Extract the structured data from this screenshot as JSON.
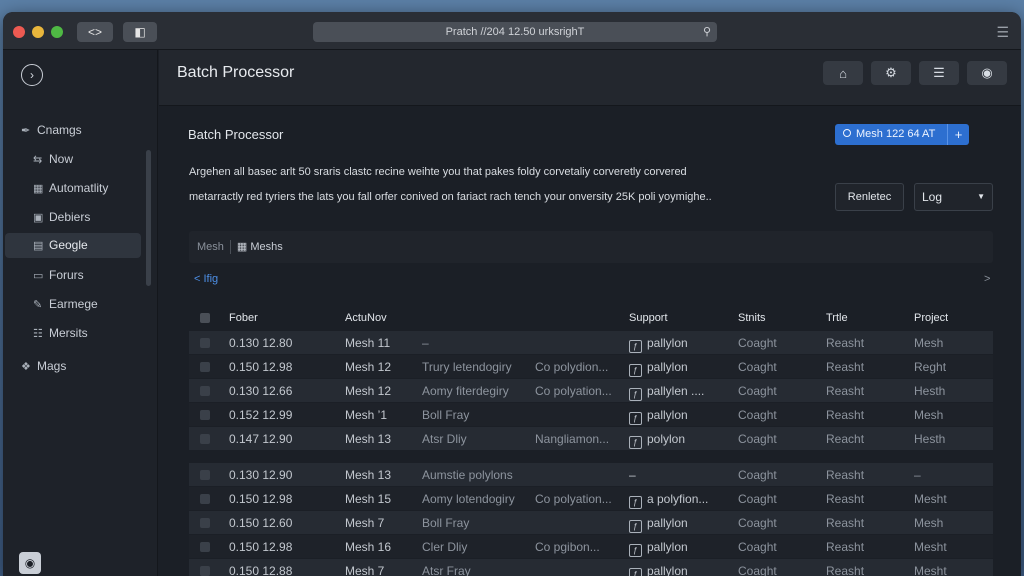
{
  "titlebar": {
    "url": "Pratch //204 12.50 urksrighT",
    "back_icon": "code-brackets-icon",
    "side_icon": "sidebar-toggle-icon",
    "search_icon": "search-icon",
    "menu_icon": "hamburger-icon"
  },
  "sidebar": {
    "items": [
      {
        "label": "Cnamgs",
        "icon": "link-icon"
      },
      {
        "label": "Now",
        "icon": "sync-icon"
      },
      {
        "label": "Automatlity",
        "icon": "grid-icon"
      },
      {
        "label": "Debiers",
        "icon": "document-icon"
      },
      {
        "label": "Geogle",
        "icon": "layers-icon"
      },
      {
        "label": "Forurs",
        "icon": "folder-icon"
      },
      {
        "label": "Earmege",
        "icon": "edit-icon"
      },
      {
        "label": "Mersits",
        "icon": "list-icon"
      },
      {
        "label": "Mags",
        "icon": "map-icon"
      }
    ]
  },
  "header": {
    "title": "Batch Processor"
  },
  "main": {
    "title": "Batch Processor",
    "mesh_pill": "Mesh 122 64 AT",
    "mesh_plus": "+",
    "desc_line1": "Argehen all basec arlt 50 sraris clastc recine weihte you that pakes foldy corvetaliy corveretly corvered",
    "desc_line2": "metarractly red tyriers the lats you fall orfer conived on fariact rach tench your onversity 25K poli yoymighe..",
    "renderer_button": "Renletec",
    "log_select": "Log",
    "tabs": [
      "Mesh",
      "Meshs"
    ],
    "back_link": "< Ifig",
    "fwd_arrow": ">"
  },
  "table": {
    "headers": {
      "col1": "Fober",
      "col2": "ActuNov",
      "col3": "Support",
      "col4": "Stnits",
      "col5": "Trtle",
      "col6": "Project"
    },
    "rows": [
      {
        "time": "0.130 12.80",
        "mesh": "Mesh 11",
        "desc": "–",
        "desc2": "",
        "support": "pallylon",
        "support_icon": true,
        "status": "Coaght",
        "title": "Reasht",
        "project": "Mesh"
      },
      {
        "time": "0.150 12.98",
        "mesh": "Mesh 12",
        "desc": "Trury letendogiry",
        "desc2": "Co polydion...",
        "support": "pallylon",
        "support_icon": true,
        "status": "Coaght",
        "title": "Reasht",
        "project": "Reght"
      },
      {
        "time": "0.130 12.66",
        "mesh": "Mesh 12",
        "desc": "Aomy fiterdegiry",
        "desc2": "Co polyation...",
        "support": "pallylen ....",
        "support_icon": true,
        "status": "Coaght",
        "title": "Reasht",
        "project": "Hesth"
      },
      {
        "time": "0.152 12.99",
        "mesh": "Mesh ’1",
        "desc": "Boll Fray",
        "desc2": "",
        "support": "pallylon",
        "support_icon": true,
        "status": "Coaght",
        "title": "Reasht",
        "project": "Mesh"
      },
      {
        "time": "0.147 12.90",
        "mesh": "Mesh 13",
        "desc": "Atsr Dliy",
        "desc2": "Nangliamon...",
        "support": "polylon",
        "support_icon": true,
        "status": "Coaght",
        "title": "Reacht",
        "project": "Hesth"
      },
      {
        "time": "0.130 12.90",
        "mesh": "Mesh 13",
        "desc": "Aumstie polylons",
        "desc2": "",
        "support": "–",
        "support_icon": false,
        "status": "Coaght",
        "title": "Reasht",
        "project": "–"
      },
      {
        "time": "0.150 12.98",
        "mesh": "Mesh 15",
        "desc": "Aomy lotendogiry",
        "desc2": "Co polyation...",
        "support": "a polyfion...",
        "support_icon": true,
        "status": "Coaght",
        "title": "Reasht",
        "project": "Mesht"
      },
      {
        "time": "0.150 12.60",
        "mesh": "Mesh  7",
        "desc": "Boll Fray",
        "desc2": "",
        "support": "pallylon",
        "support_icon": true,
        "status": "Coaght",
        "title": "Reasht",
        "project": "Mesh"
      },
      {
        "time": "0.150 12.98",
        "mesh": "Mesh 16",
        "desc": "Cler Dliy",
        "desc2": "Co pgibon...",
        "support": "pallylon",
        "support_icon": true,
        "status": "Coaght",
        "title": "Reasht",
        "project": "Mesht"
      },
      {
        "time": "0.150 12.88",
        "mesh": "Mesh 7",
        "desc": "Atsr Fray",
        "desc2": "",
        "support": "pallylon",
        "support_icon": true,
        "status": "Coaght",
        "title": "Reasht",
        "project": "Mesht"
      }
    ]
  }
}
